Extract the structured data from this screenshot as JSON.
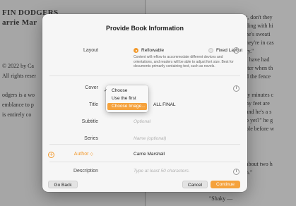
{
  "background": {
    "left_page": {
      "title_lines": [
        "FIN DODGERS",
        "arrie Mar"
      ],
      "lines": [
        "© 2022 by Ca",
        "All rights reser",
        "",
        "odgers is a wo",
        "emblance to p",
        "is entirely co"
      ]
    },
    "right_page": {
      "lines": [
        "t, don't they",
        "ding with hi",
        "he's sweati",
        "hey're in cas",
        "ry.\"",
        "I have had",
        "tter when th",
        "d the fence",
        "",
        "ty minutes c",
        "ny feet are",
        "and he's a s",
        "p yet?\" he g",
        "ble before w",
        "",
        "",
        "about two h",
        "n.\"",
        "",
        "\"Shaky —",
        ""
      ]
    }
  },
  "dialog": {
    "title": "Provide Book Information",
    "layout": {
      "label": "Layout",
      "option_reflowable": "Reflowable",
      "option_fixed": "Fixed Layout",
      "selected": "Reflowable",
      "description": "Content will reflow to accommodate different devices and orientations, and readers will be able to adjust font size. Best for documents primarily containing text, such as novels."
    },
    "cover": {
      "label": "Cover"
    },
    "title_field": {
      "label": "Title",
      "value": "ALL FINAL"
    },
    "subtitle": {
      "label": "Subtitle",
      "placeholder": "Optional"
    },
    "series": {
      "label": "Series",
      "placeholder": "Name (optional)"
    },
    "author": {
      "label": "Author",
      "value": "Carrie Marshall"
    },
    "description": {
      "label": "Description",
      "placeholder": "Type at least 50 characters."
    },
    "buttons": {
      "go_back": "Go Back",
      "cancel": "Cancel",
      "continue": "Continue"
    },
    "info_glyph": "i",
    "plus_glyph": "+",
    "author_stepper_glyph": "◇"
  },
  "cover_menu": {
    "items": [
      {
        "label": "Choose",
        "checked": true,
        "highlighted": false
      },
      {
        "label": "Use the first page",
        "checked": false,
        "highlighted": false
      },
      {
        "label": "Choose Image...",
        "checked": false,
        "highlighted": true
      }
    ],
    "check_glyph": "✓"
  },
  "colors": {
    "accent": "#f29a2e",
    "continue_button": "#f5a23c"
  }
}
